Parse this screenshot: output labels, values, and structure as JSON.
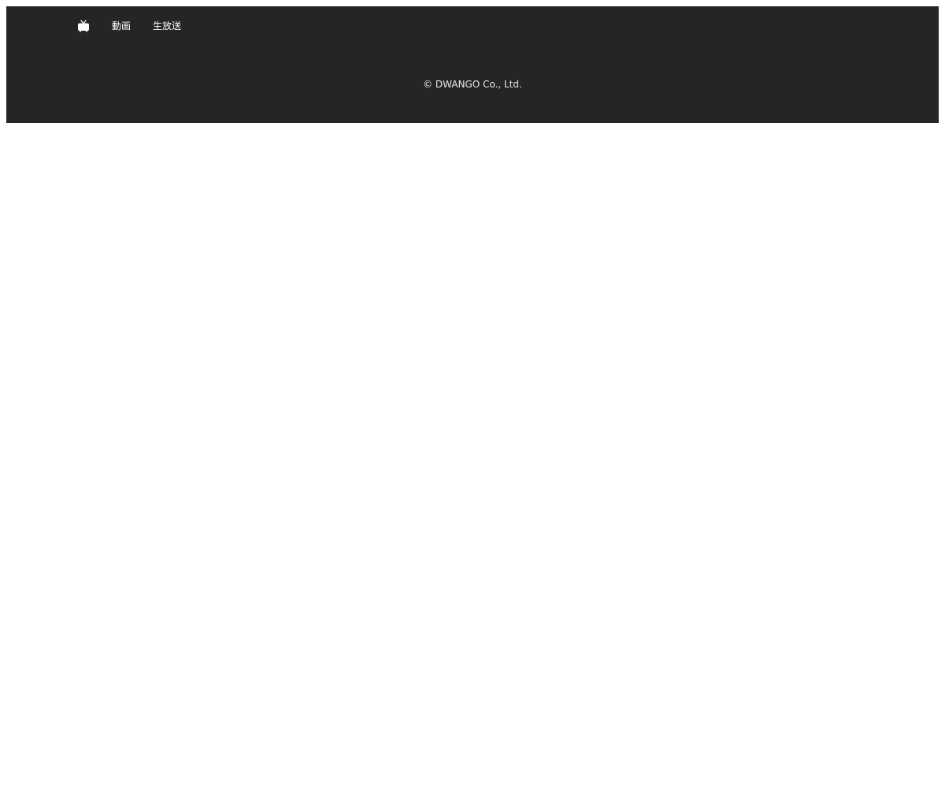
{
  "footer": {
    "nav": {
      "home_icon": "niconico-tv-icon",
      "items": [
        {
          "label": "動画"
        },
        {
          "label": "生放送"
        }
      ]
    },
    "copyright": "© DWANGO Co., Ltd."
  },
  "colors": {
    "footer_bg": "#252525",
    "nav_text": "#ffffff",
    "copyright_text": "#eaeaea",
    "page_bg": "#ffffff"
  }
}
